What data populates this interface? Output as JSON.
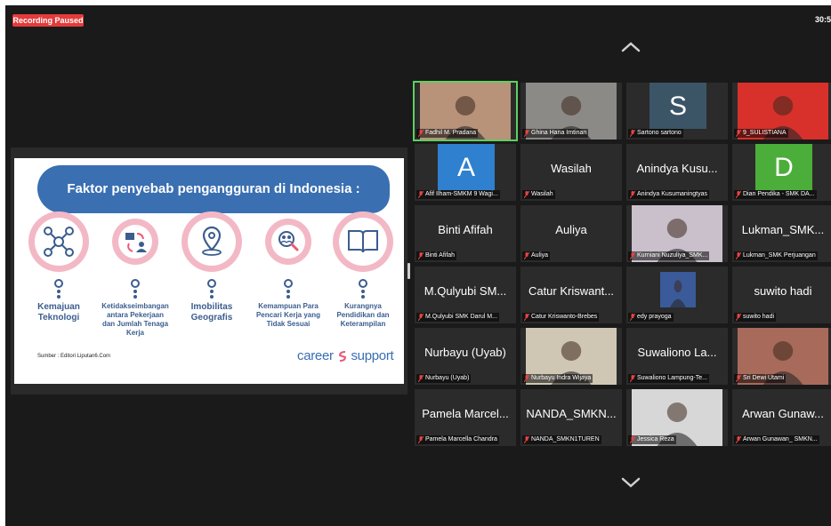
{
  "recording_status": "Recording Paused",
  "timer": "30:5",
  "slide": {
    "title": "Faktor penyebab pengangguran di Indonesia :",
    "factors": [
      {
        "label": "Kemajuan Teknologi",
        "icon": "network-icon"
      },
      {
        "label": "Ketidakseimbangan antara Pekerjaan dan Jumlah Tenaga Kerja",
        "icon": "exchange-person-icon"
      },
      {
        "label": "Imobilitas Geografis",
        "icon": "location-pin-icon"
      },
      {
        "label": "Kemampuan Para Pencari Kerja yang Tidak Sesuai",
        "icon": "search-people-icon"
      },
      {
        "label": "Kurangnya Pendidikan dan Keterampilan",
        "icon": "open-book-icon"
      }
    ],
    "source": "Sumber : Editori Liputan6.Com",
    "brand": "career",
    "brand2": "support"
  },
  "participants": [
    {
      "display": "",
      "caption": "Fadhil M. Pradana",
      "video": "camera",
      "bg": "#b9927a"
    },
    {
      "display": "",
      "caption": "Ghina Hana Imtinan",
      "video": "camera",
      "bg": "#8c8a86"
    },
    {
      "display": "S",
      "caption": "Sartono sartono",
      "video": "letter",
      "bg": "#3b5566"
    },
    {
      "display": "",
      "caption": "9_SULISTIANA",
      "video": "camera",
      "bg": "#d8312b"
    },
    {
      "display": "A",
      "caption": "Afif Ilham-SMKM 9 Wagi...",
      "video": "letter",
      "bg": "#2f80ce"
    },
    {
      "display": "Wasilah",
      "caption": "Wasilah",
      "video": "off",
      "bg": ""
    },
    {
      "display": "Anindya Kusu...",
      "caption": "Anindya Kusumaningtyas",
      "video": "off",
      "bg": ""
    },
    {
      "display": "D",
      "caption": "Dian Pendika - SMK DA...",
      "video": "letter",
      "bg": "#4cae3a"
    },
    {
      "display": "Binti Afifah",
      "caption": "Binti Afifah",
      "video": "off",
      "bg": ""
    },
    {
      "display": "Auliya",
      "caption": "Auliya",
      "video": "off",
      "bg": ""
    },
    {
      "display": "",
      "caption": "Kurniani Nuzuliya_SMK...",
      "video": "camera",
      "bg": "#c9c0cc"
    },
    {
      "display": "Lukman_SMK...",
      "caption": "Lukman_SMK Perjuangan",
      "video": "off",
      "bg": ""
    },
    {
      "display": "M.Qulyubi SM...",
      "caption": "M.Qulyubi SMK Darul M...",
      "video": "off",
      "bg": ""
    },
    {
      "display": "Catur Kriswant...",
      "caption": "Catur Kriswanto-Brebes",
      "video": "off",
      "bg": ""
    },
    {
      "display": "",
      "caption": "edy prayoga",
      "video": "camera-small",
      "bg": "#3a5a9a"
    },
    {
      "display": "suwito hadi",
      "caption": "suwito hadi",
      "video": "off",
      "bg": ""
    },
    {
      "display": "Nurbayu (Uyab)",
      "caption": "Nurbayu (Uyab)",
      "video": "off",
      "bg": ""
    },
    {
      "display": "",
      "caption": "Nurbayu Indra Wijaya",
      "video": "camera",
      "bg": "#cfc6b4"
    },
    {
      "display": "Suwaliono La...",
      "caption": "Suwaliono Lampung-Te...",
      "video": "off",
      "bg": ""
    },
    {
      "display": "",
      "caption": "Sri Dewi Utami",
      "video": "camera",
      "bg": "#a86a5a"
    },
    {
      "display": "Pamela Marcel...",
      "caption": "Pamela Marcella Chandra",
      "video": "off",
      "bg": ""
    },
    {
      "display": "NANDA_SMKN...",
      "caption": "NANDA_SMKN1TUREN",
      "video": "off",
      "bg": ""
    },
    {
      "display": "",
      "caption": "Jessica Reza",
      "video": "camera",
      "bg": "#d7d7d7"
    },
    {
      "display": "Arwan Gunaw...",
      "caption": "Arwan Gunawan_ SMKN...",
      "video": "off",
      "bg": ""
    }
  ]
}
